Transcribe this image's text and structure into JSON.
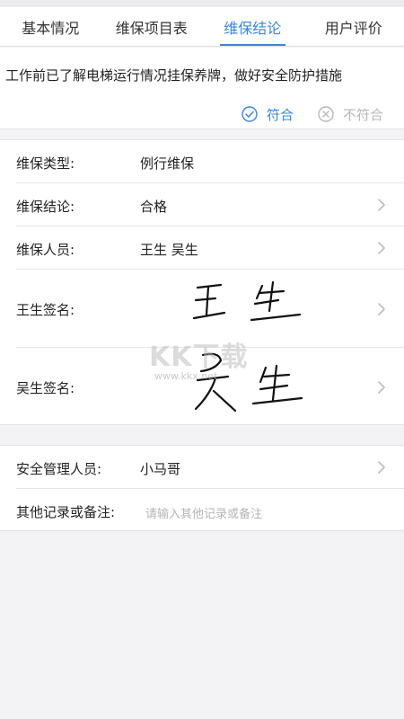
{
  "tabs": [
    {
      "label": "基本情况",
      "active": false
    },
    {
      "label": "维保项目表",
      "active": false
    },
    {
      "label": "维保结论",
      "active": true
    },
    {
      "label": "用户评价",
      "active": false
    }
  ],
  "requirement": {
    "text": "工作前已了解电梯运行情况挂保养牌，做好安全防护措施",
    "conform_label": "符合",
    "conform_icon": "check-circle-icon",
    "nonconform_label": "不符合",
    "nonconform_icon": "x-circle-icon",
    "selected": "conform"
  },
  "details": {
    "type_label": "维保类型:",
    "type_value": "例行维保",
    "conclusion_label": "维保结论:",
    "conclusion_value": "合格",
    "staff_label": "维保人员:",
    "staff_value": "王生 吴生",
    "sign1_label": "王生签名:",
    "sign2_label": "吴生签名:"
  },
  "extra": {
    "manager_label": "安全管理人员:",
    "manager_value": "小马哥",
    "notes_label": "其他记录或备注:",
    "notes_placeholder": "请输入其他记录或备注"
  },
  "watermark": {
    "brand": "KK下载",
    "url": "www.kkx.net"
  },
  "colors": {
    "accent": "#3b86d6",
    "muted": "#b7b7b7",
    "background": "#f3f3f5"
  }
}
